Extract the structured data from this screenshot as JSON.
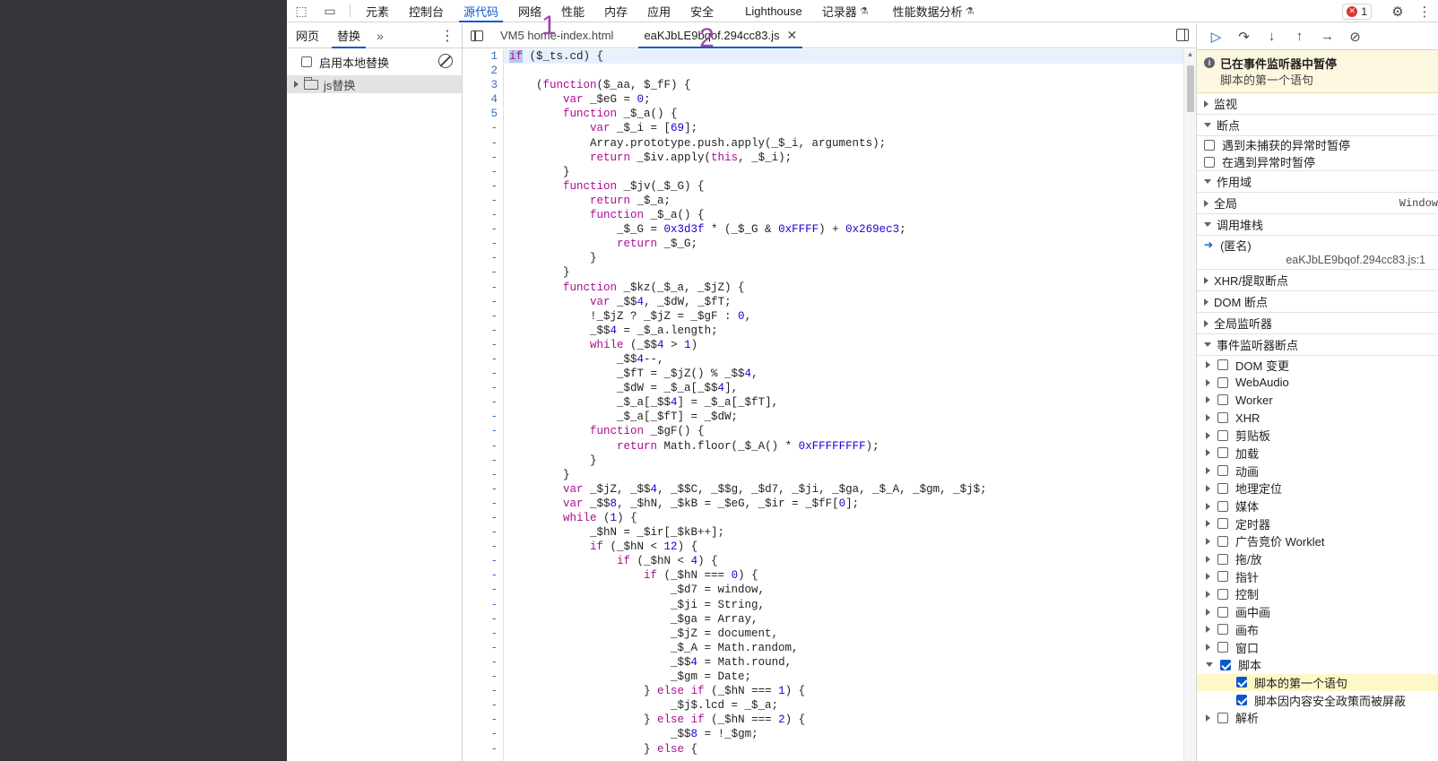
{
  "topbar": {
    "tabs": [
      {
        "label": "元素"
      },
      {
        "label": "控制台"
      },
      {
        "label": "源代码",
        "active": true
      },
      {
        "label": "网络"
      },
      {
        "label": "性能"
      },
      {
        "label": "内存"
      },
      {
        "label": "应用"
      },
      {
        "label": "安全"
      },
      {
        "label": "Lighthouse"
      },
      {
        "label": "记录器",
        "flask": true
      },
      {
        "label": "性能数据分析",
        "flask": true
      }
    ],
    "error_count": "1"
  },
  "navigator": {
    "tabs": [
      "网页",
      "替换"
    ],
    "active_tab": "替换",
    "override_label": "启用本地替换",
    "folder": "js替换"
  },
  "editor": {
    "tabs": [
      {
        "label": "VM5 home-index.html"
      },
      {
        "label": "eaKJbLE9bqof.294cc83.js",
        "active": true,
        "closable": true
      }
    ],
    "annotations": [
      "1",
      "2"
    ],
    "line_numbers": [
      "1",
      "2",
      "3",
      "4",
      "5",
      "-",
      "-",
      "-",
      "-",
      "-",
      "-",
      "-",
      "-",
      "-",
      "-",
      "-",
      "-",
      "-",
      "-",
      "-",
      "-",
      "-",
      "-",
      "-",
      "-",
      "-",
      "-",
      "-",
      "-",
      "-",
      "-",
      "-",
      "-",
      "-",
      "-",
      "-",
      "-",
      "-",
      "-",
      "-",
      "-",
      "-",
      "-",
      "-",
      "-",
      "-",
      "-",
      "-",
      "-",
      "-",
      "-",
      "-",
      "-",
      "-",
      "-",
      "-"
    ],
    "code_lines": [
      "if ($_ts.cd) {",
      "",
      "    (function($_aa, $_fF) {",
      "        var _$eG = 0;",
      "        function _$_a() {",
      "            var _$_i = [69];",
      "            Array.prototype.push.apply(_$_i, arguments);",
      "            return _$iv.apply(this, _$_i);",
      "        }",
      "        function _$jv(_$_G) {",
      "            return _$_a;",
      "            function _$_a() {",
      "                _$_G = 0x3d3f * (_$_G & 0xFFFF) + 0x269ec3;",
      "                return _$_G;",
      "            }",
      "        }",
      "        function _$kz(_$_a, _$jZ) {",
      "            var _$$4, _$dW, _$fT;",
      "            !_$jZ ? _$jZ = _$gF : 0,",
      "            _$$4 = _$_a.length;",
      "            while (_$$4 > 1)",
      "                _$$4--,",
      "                _$fT = _$jZ() % _$$4,",
      "                _$dW = _$_a[_$$4],",
      "                _$_a[_$$4] = _$_a[_$fT],",
      "                _$_a[_$fT] = _$dW;",
      "            function _$gF() {",
      "                return Math.floor(_$_A() * 0xFFFFFFFF);",
      "            }",
      "        }",
      "        var _$jZ, _$$4, _$$C, _$$g, _$d7, _$ji, _$ga, _$_A, _$gm, _$j$;",
      "        var _$$8, _$hN, _$kB = _$eG, _$ir = _$fF[0];",
      "        while (1) {",
      "            _$hN = _$ir[_$kB++];",
      "            if (_$hN < 12) {",
      "                if (_$hN < 4) {",
      "                    if (_$hN === 0) {",
      "                        _$d7 = window,",
      "                        _$ji = String,",
      "                        _$ga = Array,",
      "                        _$jZ = document,",
      "                        _$_A = Math.random,",
      "                        _$$4 = Math.round,",
      "                        _$gm = Date;",
      "                    } else if (_$hN === 1) {",
      "                        _$j$.lcd = _$_a;",
      "                    } else if (_$hN === 2) {",
      "                        _$$8 = !_$gm;",
      "                    } else {"
    ]
  },
  "debugger": {
    "paused_title": "已在事件监听器中暂停",
    "paused_reason": "脚本的第一个语句",
    "sections": {
      "watch": "监视",
      "breakpoints": "断点",
      "scope": "作用域",
      "callstack": "调用堆栈",
      "xhr": "XHR/提取断点",
      "dom": "DOM 断点",
      "global": "全局监听器",
      "event": "事件监听器断点"
    },
    "bp_options": [
      "遇到未捕获的异常时暂停",
      "在遇到异常时暂停"
    ],
    "scope_global": {
      "name": "全局",
      "value": "Window"
    },
    "stack": {
      "name": "(匿名)",
      "location": "eaKJbLE9bqof.294cc83.js:1"
    },
    "events": [
      "DOM 变更",
      "WebAudio",
      "Worker",
      "XHR",
      "剪贴板",
      "加载",
      "动画",
      "地理定位",
      "媒体",
      "定时器",
      "广告竞价 Worklet",
      "拖/放",
      "指针",
      "控制",
      "画中画",
      "画布",
      "窗口"
    ],
    "script_event": "脚本",
    "script_children": [
      "脚本的第一个语句",
      "脚本因内容安全政策而被屏蔽"
    ],
    "last_event": "解析"
  }
}
